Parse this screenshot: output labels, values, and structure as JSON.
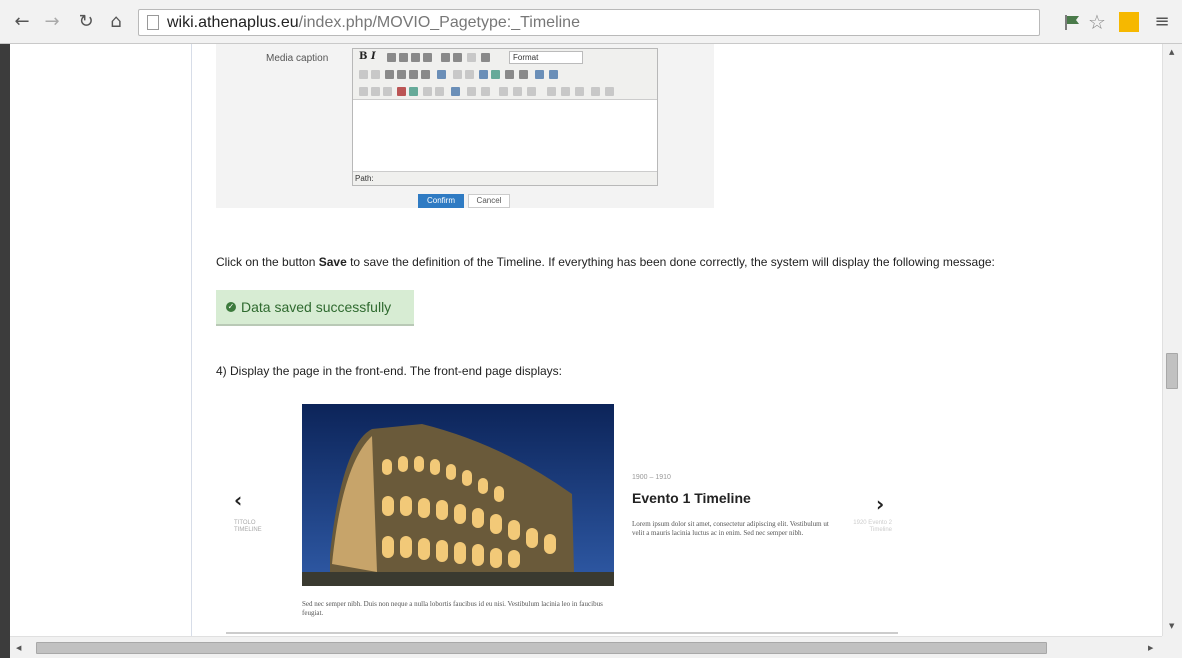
{
  "browser": {
    "url_host": "wiki.athenaplus.eu",
    "url_path": "/index.php/MOVIO_Pagetype:_Timeline",
    "back_icon": "arrow-left-icon",
    "forward_icon": "arrow-right-icon",
    "reload_icon": "reload-icon",
    "home_icon": "home-icon",
    "star_icon": "star-icon",
    "menu_icon": "menu-icon"
  },
  "editor_screenshot": {
    "field_label": "Media caption",
    "format_select": "Format",
    "path_label": "Path:",
    "confirm_label": "Confirm",
    "cancel_label": "Cancel"
  },
  "article": {
    "para1_before": "Click on the button ",
    "para1_bold": "Save",
    "para1_after": " to save the definition of the Timeline. If everything has been done correctly, the system will display the following message:",
    "success_message": "Data saved successfully",
    "para2": "4) Display the page in the front-end. The front-end page displays:"
  },
  "timeline_shot": {
    "prev_label": "TITOLO TIMELINE",
    "next_label": "1920 Evento 2 Timeline",
    "date_range": "1900 – 1910",
    "event_title": "Evento 1 Timeline",
    "event_body": "Lorem ipsum dolor sit amet, consectetur adipiscing elit. Vestibulum ut velit a mauris lacinia luctus ac in enim. Sed nec semper nibh.",
    "image_caption": "Sed nec semper nibh. Duis non neque a nulla lobortis faucibus id eu nisi. Vestibulum lacinia leo in faucibus feugiat."
  },
  "colors": {
    "success_bg": "#d7ecd3",
    "success_text": "#2f6a2f",
    "confirm_bg": "#2f7bc3"
  }
}
